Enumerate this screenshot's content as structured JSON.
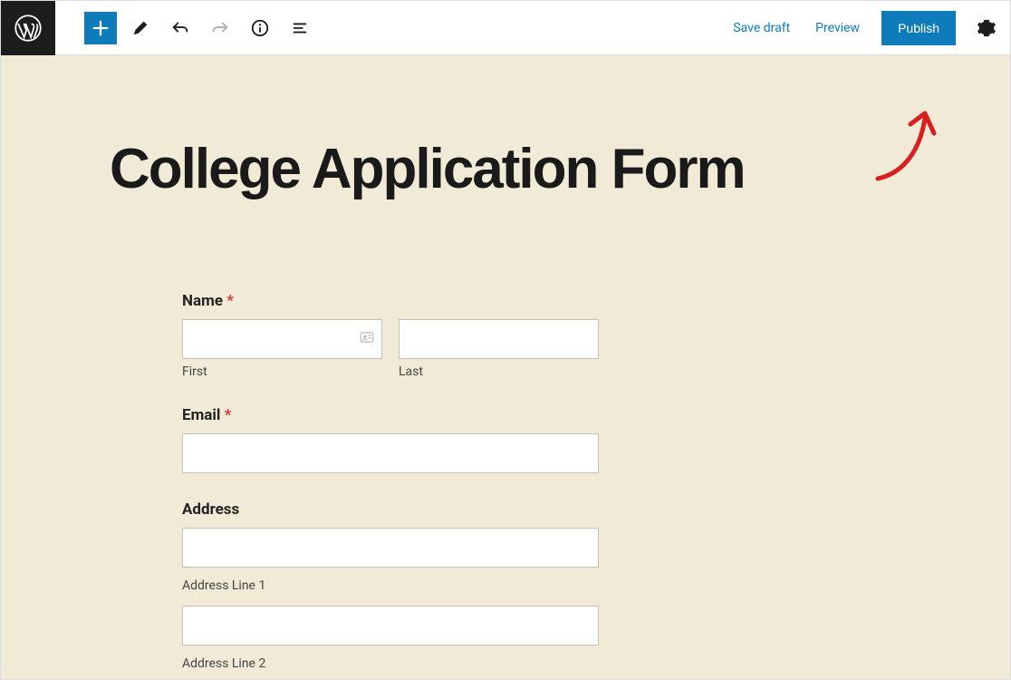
{
  "toolbar": {
    "save_draft": "Save draft",
    "preview": "Preview",
    "publish": "Publish"
  },
  "page": {
    "title": "College Application Form"
  },
  "form": {
    "name": {
      "label": "Name",
      "required_mark": "*",
      "first_sublabel": "First",
      "last_sublabel": "Last",
      "first_value": "",
      "last_value": ""
    },
    "email": {
      "label": "Email",
      "required_mark": "*",
      "value": ""
    },
    "address": {
      "label": "Address",
      "line1_sublabel": "Address Line 1",
      "line2_sublabel": "Address Line 2",
      "line1_value": "",
      "line2_value": ""
    }
  }
}
